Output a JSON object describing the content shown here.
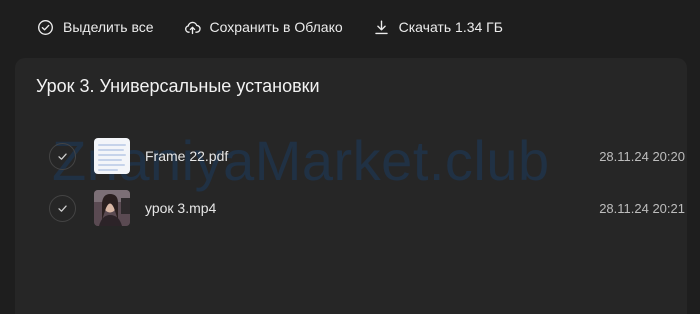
{
  "toolbar": {
    "select_all_label": "Выделить все",
    "save_cloud_label": "Сохранить в Облако",
    "download_label": "Скачать 1.34 ГБ"
  },
  "folder": {
    "title": "Урок 3. Универсальные установки"
  },
  "files": [
    {
      "name": "Frame 22.pdf",
      "date": "28.11.24 20:20",
      "type": "pdf"
    },
    {
      "name": "урок 3.mp4",
      "date": "28.11.24 20:21",
      "type": "video"
    }
  ],
  "watermark": "ZnaniyaMarket.club",
  "colors": {
    "background": "#1e1e1e",
    "panel": "#262626",
    "text": "#e6e6e6",
    "muted_text": "#bdbdbd",
    "watermark": "#1c3a5e"
  },
  "icons": [
    "check-circle-icon",
    "cloud-upload-icon",
    "download-icon",
    "checkmark-icon"
  ]
}
